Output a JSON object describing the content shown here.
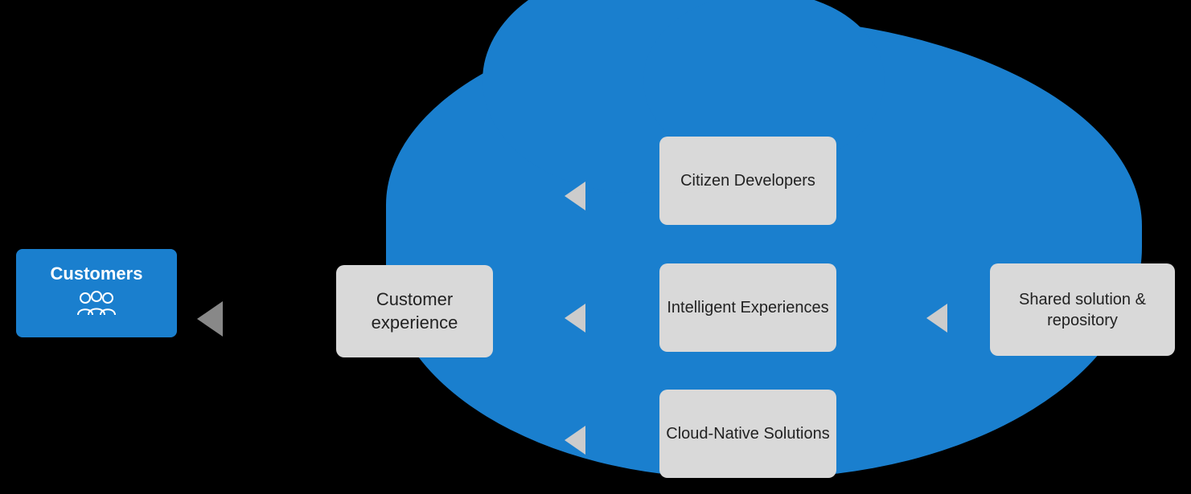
{
  "diagram": {
    "background": "#000000",
    "cloud_color": "#1a7fce",
    "box_color": "#d9d9d9",
    "customers": {
      "label": "Customers",
      "icon": "👥"
    },
    "customer_experience": {
      "label": "Customer experience"
    },
    "citizen_developers": {
      "label": "Citizen Developers"
    },
    "intelligent_experiences": {
      "label": "Intelligent Experiences"
    },
    "cloud_native_solutions": {
      "label": "Cloud-Native Solutions"
    },
    "shared_solution_repository": {
      "label": "Shared solution & repository"
    }
  }
}
